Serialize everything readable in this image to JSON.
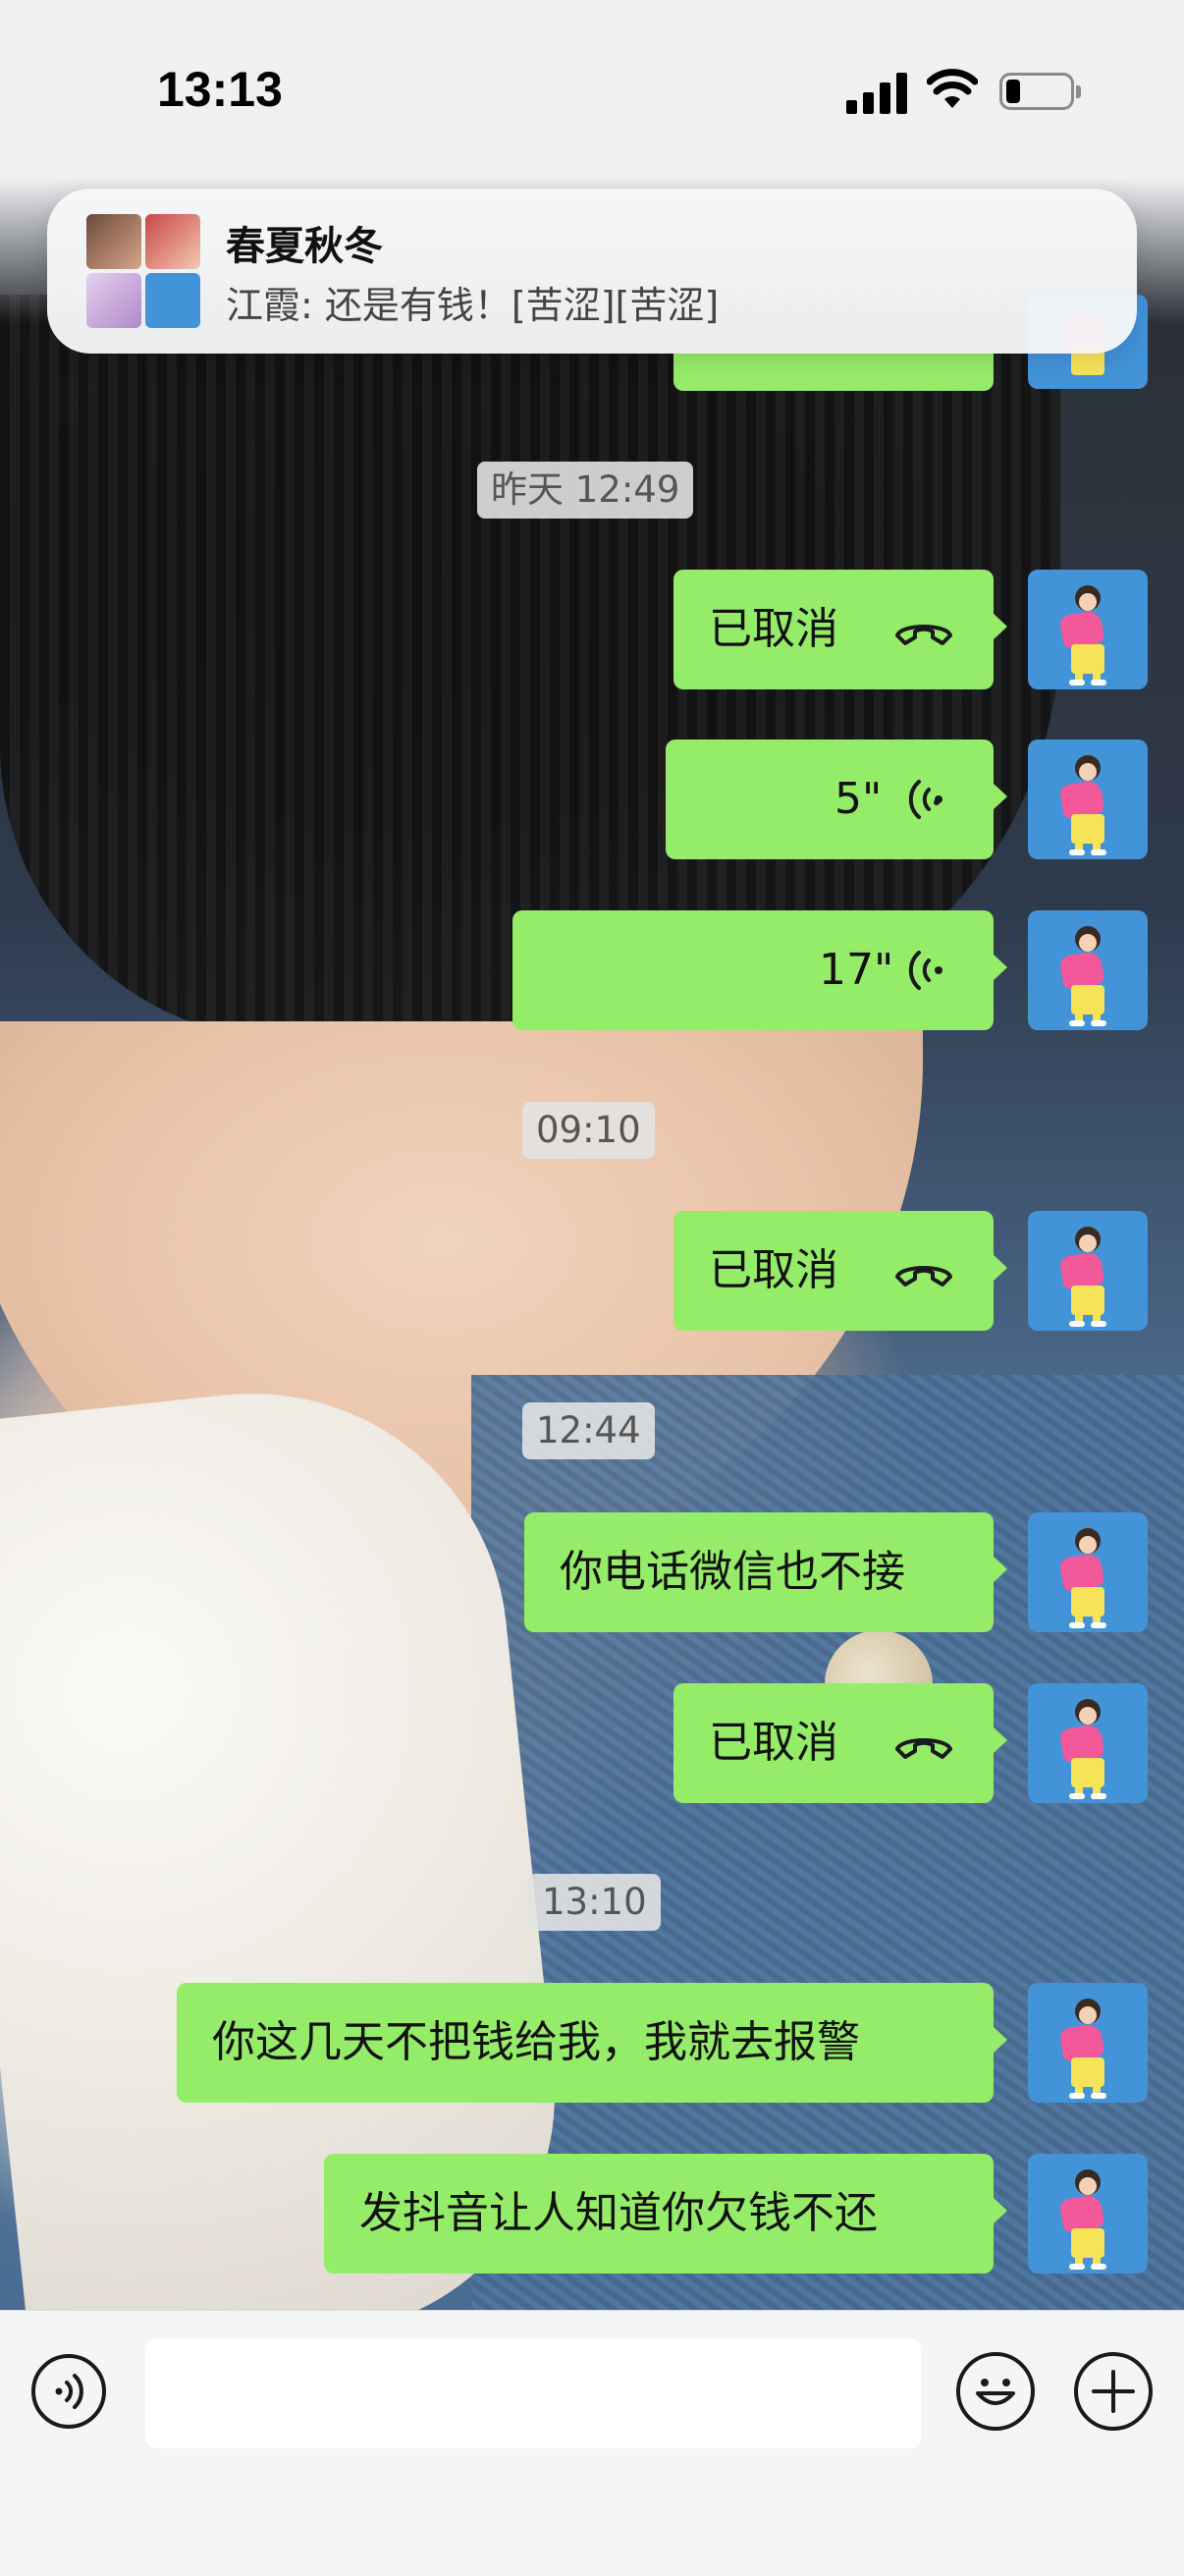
{
  "status_bar": {
    "time": "13:13"
  },
  "notification": {
    "title": "春夏秋冬",
    "message": "江霞: 还是有钱！[苦涩][苦涩]"
  },
  "messages": [
    {
      "type": "timestamp",
      "text": "昨天 12:49"
    },
    {
      "type": "call",
      "text": "已取消",
      "icon": "phone-hangup-icon"
    },
    {
      "type": "voice",
      "text": "5\"",
      "icon": "voice-wave-icon"
    },
    {
      "type": "voice",
      "text": "17\"",
      "icon": "voice-wave-icon"
    },
    {
      "type": "timestamp",
      "text": "09:10"
    },
    {
      "type": "call",
      "text": "已取消",
      "icon": "phone-hangup-icon"
    },
    {
      "type": "timestamp",
      "text": "12:44"
    },
    {
      "type": "text",
      "text": "你电话微信也不接"
    },
    {
      "type": "call",
      "text": "已取消",
      "icon": "phone-hangup-icon"
    },
    {
      "type": "timestamp",
      "text": "13:10"
    },
    {
      "type": "text",
      "text": "你这几天不把钱给我，我就去报警"
    },
    {
      "type": "text",
      "text": "发抖音让人知道你欠钱不还"
    }
  ],
  "input_bar": {
    "voice_icon": "voice-mode-icon",
    "input_value": "",
    "emoji_icon": "emoji-icon",
    "plus_icon": "plus-icon"
  },
  "colors": {
    "bubble_green": "#95ec69",
    "avatar_blue": "#4293d8"
  }
}
